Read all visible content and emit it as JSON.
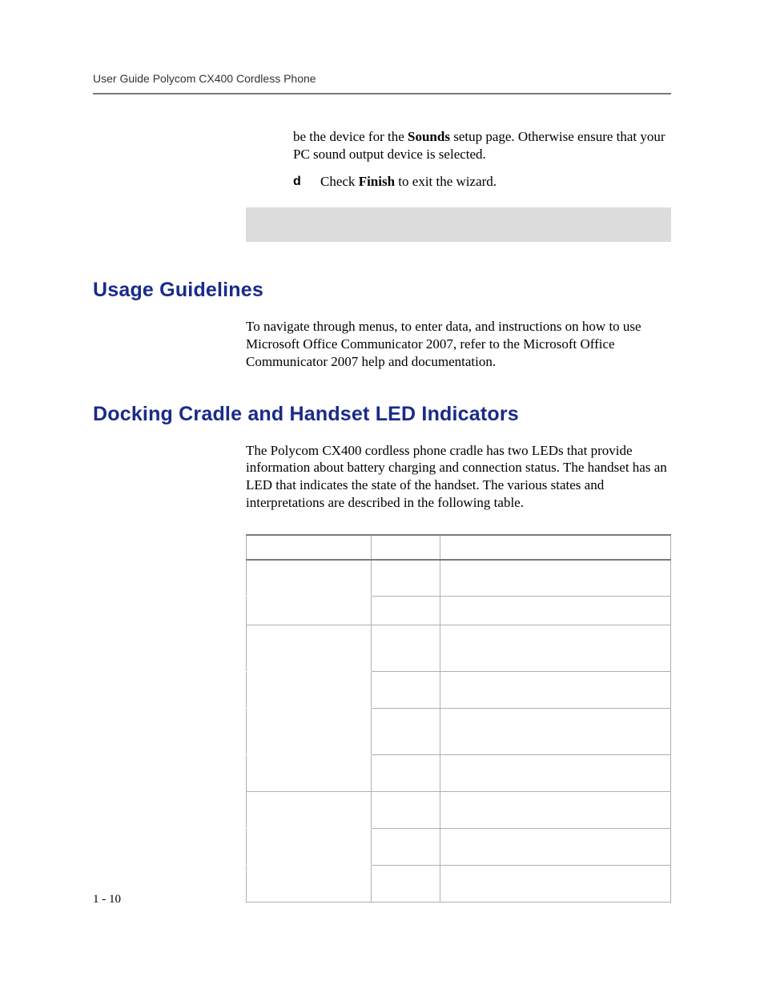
{
  "header": {
    "running_title": "User Guide Polycom CX400 Cordless Phone"
  },
  "continuation": {
    "p1_a": "be the device for the ",
    "p1_bold": "Sounds",
    "p1_b": " setup page. Otherwise ensure that your PC sound output device is selected.",
    "item_d_marker": "d",
    "item_d_a": "Check ",
    "item_d_bold": "Finish",
    "item_d_b": " to exit the wizard."
  },
  "sections": {
    "usage": {
      "heading": "Usage Guidelines",
      "body": "To navigate through menus, to enter data, and instructions on how to use Microsoft Office Communicator 2007, refer to the Microsoft Office Communicator 2007 help and documentation."
    },
    "leds": {
      "heading": "Docking Cradle and Handset LED Indicators",
      "body": "The Polycom CX400 cordless phone cradle has two LEDs that provide information about battery charging and connection status. The handset has an LED that indicates the state of the handset. The various states and interpretations are described in the following table."
    }
  },
  "page_number": "1 - 10"
}
